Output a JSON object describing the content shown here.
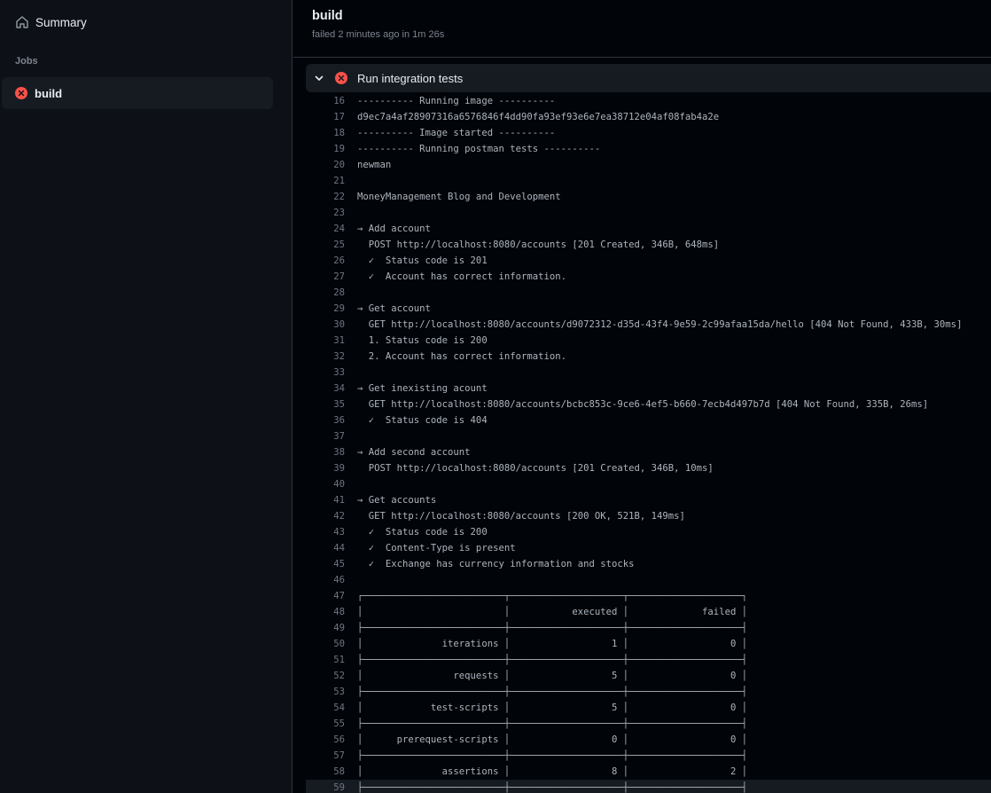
{
  "sidebar": {
    "summary_label": "Summary",
    "jobs_heading": "Jobs",
    "job": {
      "label": "build",
      "status": "failed"
    }
  },
  "header": {
    "title": "build",
    "subtitle": "failed 2 minutes ago in 1m 26s"
  },
  "step": {
    "label": "Run integration tests",
    "status": "failed"
  },
  "colors": {
    "failure": "#f85149",
    "background": "#010409",
    "sidebar": "#0d1117",
    "panel": "#161b22"
  },
  "log": [
    {
      "n": "16",
      "t": "---------- Running image ----------"
    },
    {
      "n": "17",
      "t": "d9ec7a4af28907316a6576846f4dd90fa93ef93e6e7ea38712e04af08fab4a2e"
    },
    {
      "n": "18",
      "t": "---------- Image started ----------"
    },
    {
      "n": "19",
      "t": "---------- Running postman tests ----------"
    },
    {
      "n": "20",
      "t": "newman"
    },
    {
      "n": "21",
      "t": ""
    },
    {
      "n": "22",
      "t": "MoneyManagement Blog and Development"
    },
    {
      "n": "23",
      "t": ""
    },
    {
      "n": "24",
      "t": "→ Add account"
    },
    {
      "n": "25",
      "t": "  POST http://localhost:8080/accounts [201 Created, 346B, 648ms]"
    },
    {
      "n": "26",
      "t": "  ✓  Status code is 201"
    },
    {
      "n": "27",
      "t": "  ✓  Account has correct information."
    },
    {
      "n": "28",
      "t": ""
    },
    {
      "n": "29",
      "t": "→ Get account"
    },
    {
      "n": "30",
      "t": "  GET http://localhost:8080/accounts/d9072312-d35d-43f4-9e59-2c99afaa15da/hello [404 Not Found, 433B, 30ms]"
    },
    {
      "n": "31",
      "t": "  1. Status code is 200"
    },
    {
      "n": "32",
      "t": "  2. Account has correct information."
    },
    {
      "n": "33",
      "t": ""
    },
    {
      "n": "34",
      "t": "→ Get inexisting acount"
    },
    {
      "n": "35",
      "t": "  GET http://localhost:8080/accounts/bcbc853c-9ce6-4ef5-b660-7ecb4d497b7d [404 Not Found, 335B, 26ms]"
    },
    {
      "n": "36",
      "t": "  ✓  Status code is 404"
    },
    {
      "n": "37",
      "t": ""
    },
    {
      "n": "38",
      "t": "→ Add second account"
    },
    {
      "n": "39",
      "t": "  POST http://localhost:8080/accounts [201 Created, 346B, 10ms]"
    },
    {
      "n": "40",
      "t": ""
    },
    {
      "n": "41",
      "t": "→ Get accounts"
    },
    {
      "n": "42",
      "t": "  GET http://localhost:8080/accounts [200 OK, 521B, 149ms]"
    },
    {
      "n": "43",
      "t": "  ✓  Status code is 200"
    },
    {
      "n": "44",
      "t": "  ✓  Content-Type is present"
    },
    {
      "n": "45",
      "t": "  ✓  Exchange has currency information and stocks"
    },
    {
      "n": "46",
      "t": ""
    },
    {
      "n": "47",
      "t": "┌─────────────────────────┬────────────────────┬────────────────────┐"
    },
    {
      "n": "48",
      "t": "│                         │           executed │             failed │"
    },
    {
      "n": "49",
      "t": "├─────────────────────────┼────────────────────┼────────────────────┤"
    },
    {
      "n": "50",
      "t": "│              iterations │                  1 │                  0 │"
    },
    {
      "n": "51",
      "t": "├─────────────────────────┼────────────────────┼────────────────────┤"
    },
    {
      "n": "52",
      "t": "│                requests │                  5 │                  0 │"
    },
    {
      "n": "53",
      "t": "├─────────────────────────┼────────────────────┼────────────────────┤"
    },
    {
      "n": "54",
      "t": "│            test-scripts │                  5 │                  0 │"
    },
    {
      "n": "55",
      "t": "├─────────────────────────┼────────────────────┼────────────────────┤"
    },
    {
      "n": "56",
      "t": "│      prerequest-scripts │                  0 │                  0 │"
    },
    {
      "n": "57",
      "t": "├─────────────────────────┼────────────────────┼────────────────────┤"
    },
    {
      "n": "58",
      "t": "│              assertions │                  8 │                  2 │"
    },
    {
      "n": "59",
      "t": "├─────────────────────────┼────────────────────┼────────────────────┤",
      "highlight": true
    }
  ]
}
